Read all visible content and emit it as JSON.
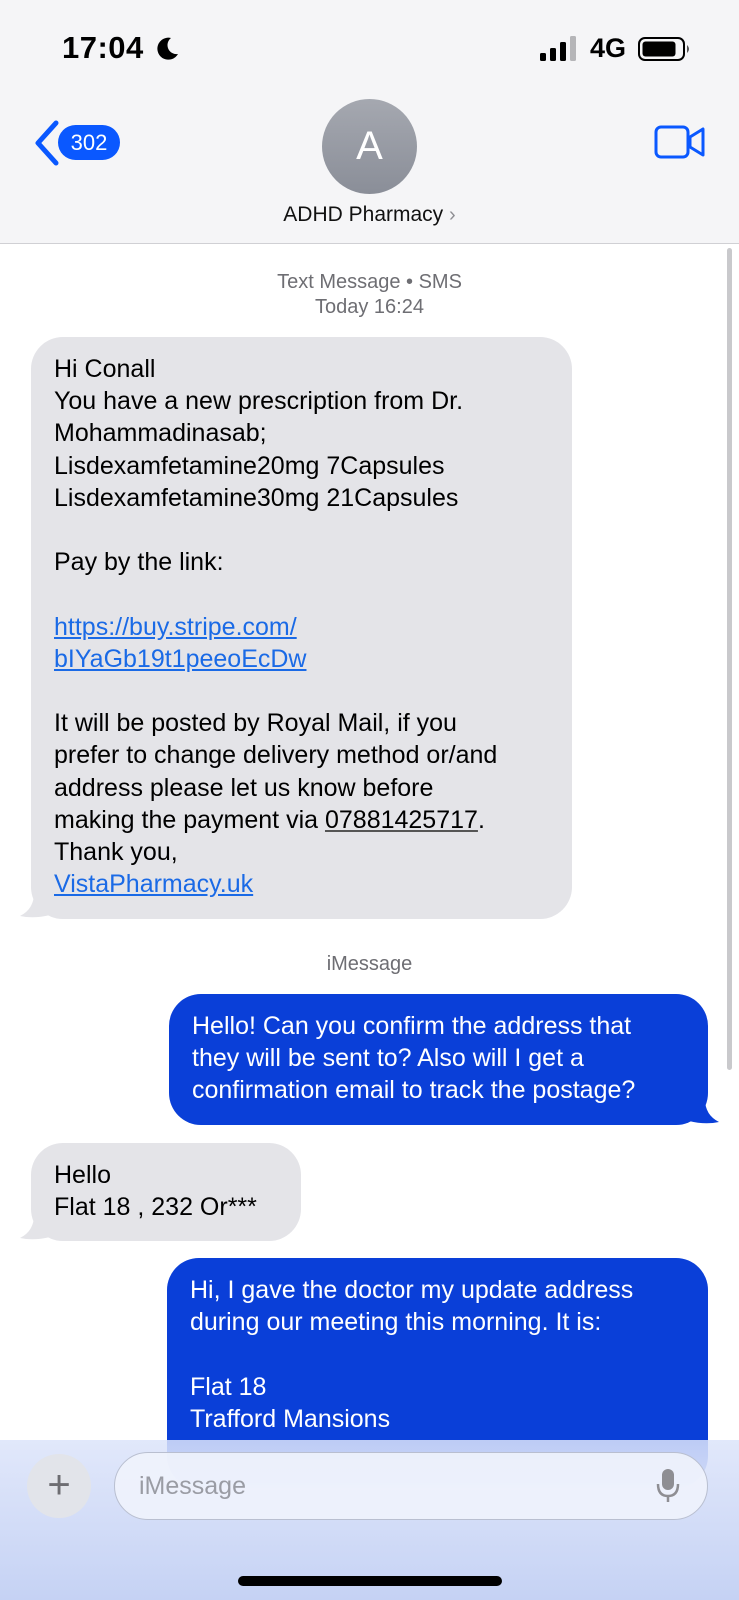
{
  "status_bar": {
    "time": "17:04",
    "network": "4G",
    "icons": [
      "moon-icon",
      "signal-icon",
      "battery-icon"
    ]
  },
  "header": {
    "back_count": "302",
    "avatar_initial": "A",
    "contact_name": "ADHD Pharmacy",
    "contact_chevron": "›",
    "icons": [
      "back-chevron-icon",
      "video-call-icon"
    ]
  },
  "thread": {
    "sms_label": "Text Message • SMS",
    "sms_time": "Today 16:24",
    "imessage_label": "iMessage",
    "messages": [
      {
        "direction": "incoming",
        "line1": "Hi Conall",
        "line2": "You have a new prescription from Dr.",
        "line3": "Mohammadinasab;",
        "line4": "Lisdexamfetamine20mg 7Capsules",
        "line5": "Lisdexamfetamine30mg 21Capsules",
        "line6": "Pay by the link:",
        "link1": "https://buy.stripe.com/",
        "link2": "bIYaGb19t1peeoEcDw",
        "line7": "It will be posted by Royal Mail, if you",
        "line8": "prefer to change delivery method or/and",
        "line9": "address please let us know before",
        "line10_pre": "making the payment via ",
        "phone": "07881425717",
        "line10_post": ".",
        "line11": "Thank you,",
        "site": "VistaPharmacy.uk"
      },
      {
        "direction": "outgoing",
        "text": "Hello! Can you confirm the address that\nthey will be sent to? Also will I get a\nconfirmation email to track the postage?"
      },
      {
        "direction": "incoming",
        "text": "Hello\nFlat 18 , 232 Or***"
      },
      {
        "direction": "outgoing",
        "text": "Hi, I gave the doctor my update address\nduring our meeting this morning. It is:\n\nFlat 18\nTrafford Mansions"
      }
    ]
  },
  "composer": {
    "plus_label": "+",
    "placeholder": "iMessage",
    "icons": [
      "plus-icon",
      "microphone-icon"
    ]
  },
  "colors": {
    "outgoing_bubble": "#0a3fd8",
    "incoming_bubble": "#e4e4e8",
    "link": "#1a6ae6",
    "accent": "#0a58ff"
  }
}
